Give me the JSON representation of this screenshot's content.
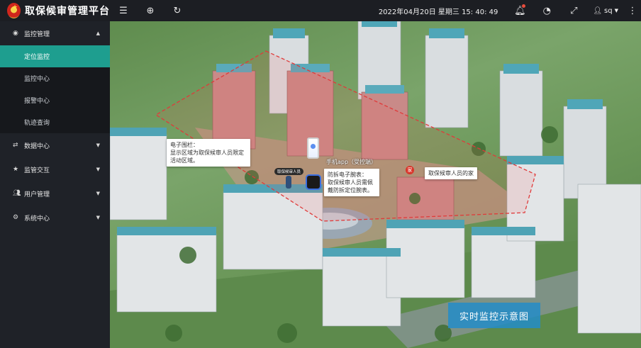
{
  "app": {
    "title": "取保候审管理平台"
  },
  "topbar": {
    "datetime": "2022年04月20日 星期三 15: 40: 49",
    "username": "sq"
  },
  "sidebar": {
    "groups": [
      {
        "label": "监控管理",
        "icon": "eye-icon",
        "expanded": true,
        "items": [
          {
            "label": "定位监控",
            "active": true
          },
          {
            "label": "监控中心"
          },
          {
            "label": "报警中心"
          },
          {
            "label": "轨迹查询"
          }
        ]
      },
      {
        "label": "数据中心",
        "icon": "shuffle-icon"
      },
      {
        "label": "监管交互",
        "icon": "star-icon"
      },
      {
        "label": "用户管理",
        "icon": "users-icon"
      },
      {
        "label": "系统中心",
        "icon": "gear-icon"
      }
    ]
  },
  "map": {
    "fence_callout": {
      "title": "电子围栏：",
      "body": "显示区域为取保候审人员限定活动区域。"
    },
    "person_tag": "取保候审人员",
    "app_label": "手机app（受控端）",
    "wristband_callout": {
      "title": "防拆电子腕表：",
      "body": "取保候审人员需佩戴防拆定位腕表。"
    },
    "home_icon_text": "家",
    "home_label": "取保候审人员的家",
    "cta": "实时监控示意图"
  },
  "colors": {
    "accent": "#1e9e8f",
    "fence": "#e03a3a",
    "cta": "#238cc8"
  }
}
